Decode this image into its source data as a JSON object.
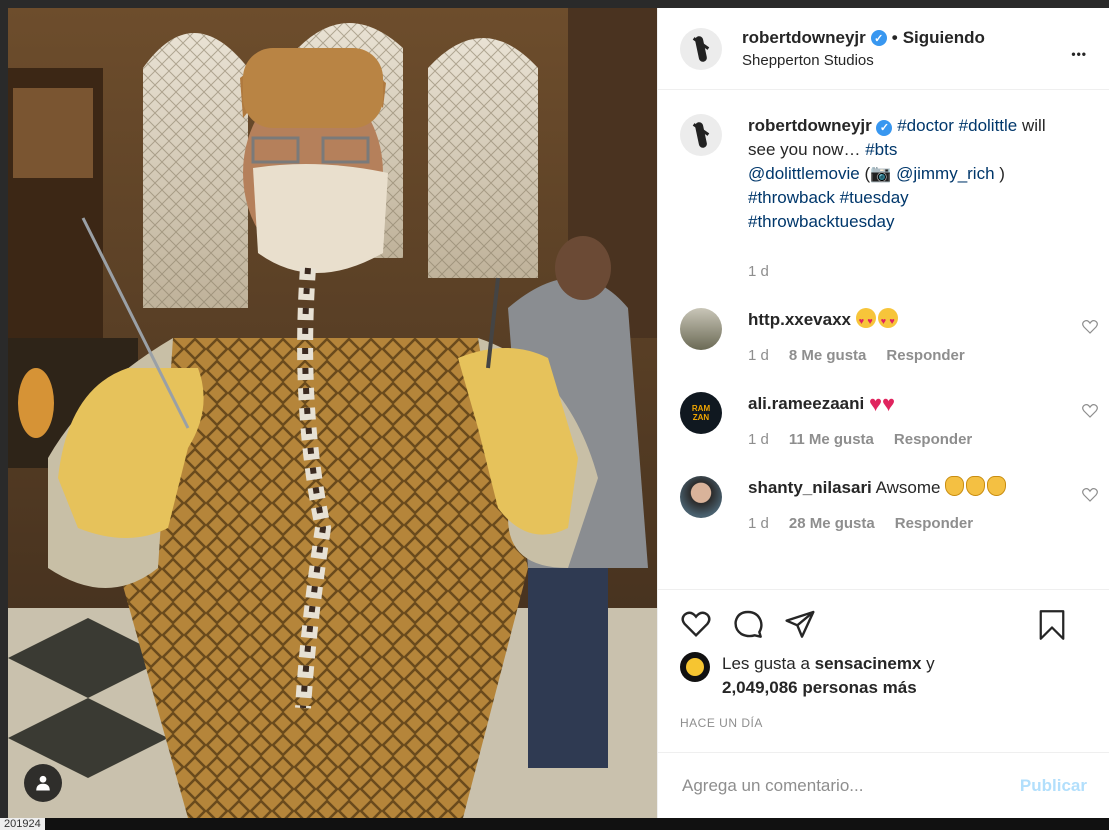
{
  "post": {
    "username": "robertdowneyjr",
    "verified_mark": "✓",
    "separator": "•",
    "follow_status": "Siguiendo",
    "location": "Shepperton Studios",
    "more_label": "•••"
  },
  "caption": {
    "username": "robertdowneyjr",
    "parts": {
      "t1": "#doctor",
      "t2": "#dolittle",
      "text1": "will see you now…",
      "t3": "#bts",
      "t4": "@dolittlemovie",
      "text2": "(",
      "camera": "📷",
      "t5": "@jimmy_rich",
      "text3": ")",
      "t6": "#throwback",
      "t7": "#tuesday",
      "t8": "#throwbacktuesday"
    },
    "time": "1 d"
  },
  "comments": [
    {
      "username": "http.xxevaxx",
      "text": "",
      "time": "1 d",
      "likes": "8 Me gusta",
      "reply": "Responder"
    },
    {
      "username": "ali.rameezaani",
      "text": "",
      "time": "1 d",
      "likes": "11 Me gusta",
      "reply": "Responder",
      "avatar_text": "RAM ZAN"
    },
    {
      "username": "shanty_nilasari",
      "text": "Awsome",
      "time": "1 d",
      "likes": "28 Me gusta",
      "reply": "Responder"
    }
  ],
  "likes": {
    "prefix": "Les gusta a",
    "first_user": "sensacinemx",
    "connector": "y",
    "rest": "2,049,086 personas más"
  },
  "timestamp": "HACE UN DÍA",
  "add_comment": {
    "placeholder": "Agrega un comentario...",
    "publish": "Publicar"
  },
  "footer_text": "201924",
  "colors": {
    "link": "#00376b",
    "verified": "#3897f0",
    "publish_disabled": "#b2dffc",
    "meta": "#8e8e8e"
  },
  "icons": [
    "user-tag-icon",
    "heart-icon",
    "comment-icon",
    "share-icon",
    "bookmark-icon",
    "verified-icon",
    "more-icon"
  ]
}
